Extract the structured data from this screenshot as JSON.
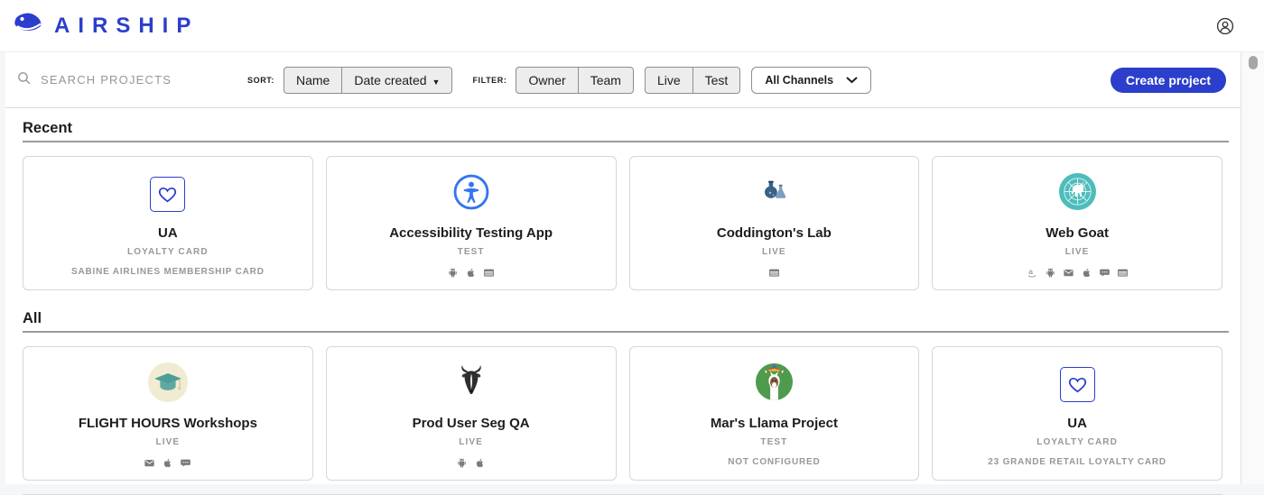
{
  "brand": {
    "name": "AIRSHIP",
    "logo_icon": "airship-logo-icon",
    "color": "#2b3ecd"
  },
  "header": {
    "account_icon": "account-icon"
  },
  "toolbar": {
    "search": {
      "placeholder": "SEARCH PROJECTS",
      "icon": "search-icon"
    },
    "sort_label": "SORT:",
    "sort_buttons": {
      "name": "Name",
      "date_created": "Date created",
      "date_caret": "▼"
    },
    "filter_label": "FILTER:",
    "filter_buttons": {
      "owner": "Owner",
      "team": "Team",
      "live": "Live",
      "test": "Test"
    },
    "channels_dropdown": {
      "value": "All Channels",
      "icon": "chevron-down-icon"
    },
    "create_label": "Create project",
    "accent_color": "#2b3ecc"
  },
  "sections": [
    {
      "title": "Recent",
      "projects": [
        {
          "name": "UA",
          "status": "LOYALTY CARD",
          "description": "SABINE AIRLINES MEMBERSHIP CARD",
          "avatar": "heart-card-icon",
          "channels": []
        },
        {
          "name": "Accessibility Testing App",
          "status": "TEST",
          "description": "",
          "avatar": "accessibility-icon",
          "channels": [
            "android",
            "apple",
            "web"
          ]
        },
        {
          "name": "Coddington's Lab",
          "status": "LIVE",
          "description": "",
          "avatar": "lab-flasks-icon",
          "channels": [
            "web"
          ]
        },
        {
          "name": "Web Goat",
          "status": "LIVE",
          "description": "",
          "avatar": "web-goat-icon",
          "channels": [
            "amazon",
            "android",
            "email",
            "apple",
            "sms",
            "web"
          ]
        }
      ]
    },
    {
      "title": "All",
      "projects": [
        {
          "name": "FLIGHT HOURS Workshops",
          "status": "LIVE",
          "description": "",
          "avatar": "graduation-cap-icon",
          "channels": [
            "email",
            "apple",
            "sms"
          ]
        },
        {
          "name": "Prod User Seg QA",
          "status": "LIVE",
          "description": "",
          "avatar": "goat-icon",
          "channels": [
            "android",
            "apple"
          ]
        },
        {
          "name": "Mar's Llama Project",
          "status": "TEST",
          "description": "NOT CONFIGURED",
          "avatar": "llama-icon",
          "channels": []
        },
        {
          "name": "UA",
          "status": "LOYALTY CARD",
          "description": "23 GRANDE RETAIL LOYALTY CARD",
          "avatar": "heart-card-icon",
          "channels": []
        }
      ]
    }
  ],
  "colors": {
    "accent_blue": "#2b3ecc",
    "access_blue": "#3575f0",
    "teal": "#4dbdbc",
    "green": "#4e9b4e",
    "cream": "#f1ebd3",
    "channel_icon_gray": "#7a7a7f"
  }
}
